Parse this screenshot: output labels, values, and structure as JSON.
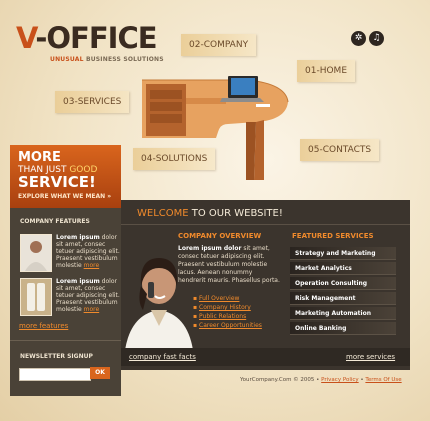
{
  "logo": {
    "letter": "V",
    "rest": "-OFFICE",
    "tagline_highlight": "UNUSUAL",
    "tagline_rest": " BUSINESS SOLUTIONS"
  },
  "top_icons": [
    "share-icon",
    "music-icon"
  ],
  "nav": {
    "company": "02-COMPANY",
    "home": "01-HOME",
    "services": "03-SERVICES",
    "solutions": "04-SOLUTIONS",
    "contacts": "05-CONTACTS"
  },
  "promo": {
    "line1": "MORE",
    "line2a": "THAN JUST ",
    "line2b": "GOOD",
    "line3": "SERVICE!",
    "cta": "EXPLORE WHAT WE MEAN »"
  },
  "sidebar": {
    "features_title": "COMPANY FEATURES",
    "features": [
      {
        "title": "Lorem ipsum",
        "text": " dolor sit amet, consec tetuer adipiscing elit. Praesent vestibulum molestie ",
        "link": "more"
      },
      {
        "title": "Lorem ipsum",
        "text": " dolor sit amet, consec tetuer adipiscing elit. Praesent vestibulum molestie ",
        "link": "more"
      }
    ],
    "more_features": "more features",
    "newsletter_title": "NEWSLETTER SIGNUP",
    "newsletter_button": "OK"
  },
  "main": {
    "welcome_a": "WELCOME ",
    "welcome_b": "TO OUR WEBSITE!",
    "overview_title": "COMPANY OVERVIEW",
    "overview_bold": "Lorem ipsum dolor",
    "overview_text": " sit amet, consec tetuer adipiscing elit. Praesent vestibulum molestie lacus. Aenean nonummy hendrerit mauris. Phasellus porta.",
    "links": [
      "Full Overview",
      "Company History",
      "Public Relations",
      "Career Opportunities"
    ],
    "services_title": "FEATURED SERVICES",
    "services": [
      "Strategy and Marketing",
      "Market Analytics",
      "Operation Consulting",
      "Risk Management",
      "Marketing Automation",
      "Online Banking"
    ],
    "fast_facts": "company fast facts",
    "more_services": "more services"
  },
  "footer": {
    "text": "YourCompany.Com © 2005 • ",
    "privacy": "Privacy Policy",
    "sep": " • ",
    "terms": "Terms Of Use"
  }
}
